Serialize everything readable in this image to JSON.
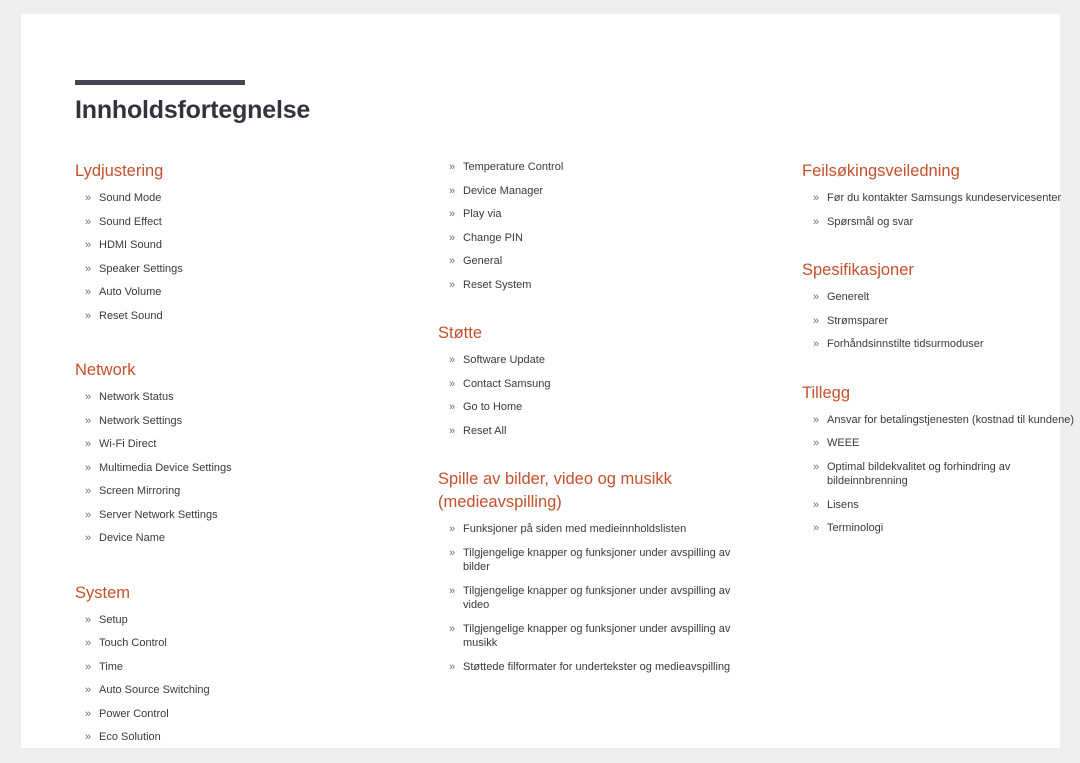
{
  "document": {
    "title": "Innholdsfortegnelse",
    "bullet_marker": "»",
    "accent_color": "#c4512e",
    "rule_color": "#454553",
    "title_color": "#33333b",
    "body_color": "#3a3a3a",
    "page_background": "#ffffff",
    "canvas_background": "#efefef"
  },
  "columns": [
    {
      "name": "left-column",
      "sections": [
        {
          "heading": "Lydjustering",
          "items": [
            "Sound Mode",
            "Sound Effect",
            "HDMI Sound",
            "Speaker Settings",
            "Auto Volume",
            "Reset Sound"
          ]
        },
        {
          "heading": "Network",
          "items": [
            "Network Status",
            "Network Settings",
            "Wi-Fi Direct",
            "Multimedia Device Settings",
            "Screen Mirroring",
            "Server Network Settings",
            "Device Name"
          ]
        },
        {
          "heading": "System",
          "items": [
            "Setup",
            "Touch Control",
            "Time",
            "Auto Source Switching",
            "Power Control",
            "Eco Solution"
          ]
        }
      ]
    },
    {
      "name": "middle-column",
      "sections": [
        {
          "heading": "",
          "items": [
            "Temperature Control",
            "Device Manager",
            "Play via",
            "Change PIN",
            "General",
            "Reset System"
          ]
        },
        {
          "heading": "Støtte",
          "items": [
            "Software Update",
            "Contact Samsung",
            "Go to Home",
            "Reset All"
          ]
        },
        {
          "heading": "Spille av bilder, video og musikk (medieavspilling)",
          "items": [
            "Funksjoner på siden med medieinnholdslisten",
            "Tilgjengelige knapper og funksjoner under avspilling av bilder",
            "Tilgjengelige knapper og funksjoner under avspilling av video",
            "Tilgjengelige knapper og funksjoner under avspilling av musikk",
            "Støttede filformater for undertekster og medieavspilling"
          ]
        }
      ]
    },
    {
      "name": "right-column",
      "sections": [
        {
          "heading": "Feilsøkingsveiledning",
          "items": [
            "Før du kontakter Samsungs kundeservicesenter",
            "Spørsmål og svar"
          ]
        },
        {
          "heading": "Spesifikasjoner",
          "items": [
            "Generelt",
            "Strømsparer",
            "Forhåndsinnstilte tidsurmoduser"
          ]
        },
        {
          "heading": "Tillegg",
          "items": [
            "Ansvar for betalingstjenesten (kostnad til kundene)",
            "WEEE",
            "Optimal bildekvalitet og forhindring av bildeinnbrenning",
            "Lisens",
            "Terminologi"
          ]
        }
      ]
    }
  ]
}
